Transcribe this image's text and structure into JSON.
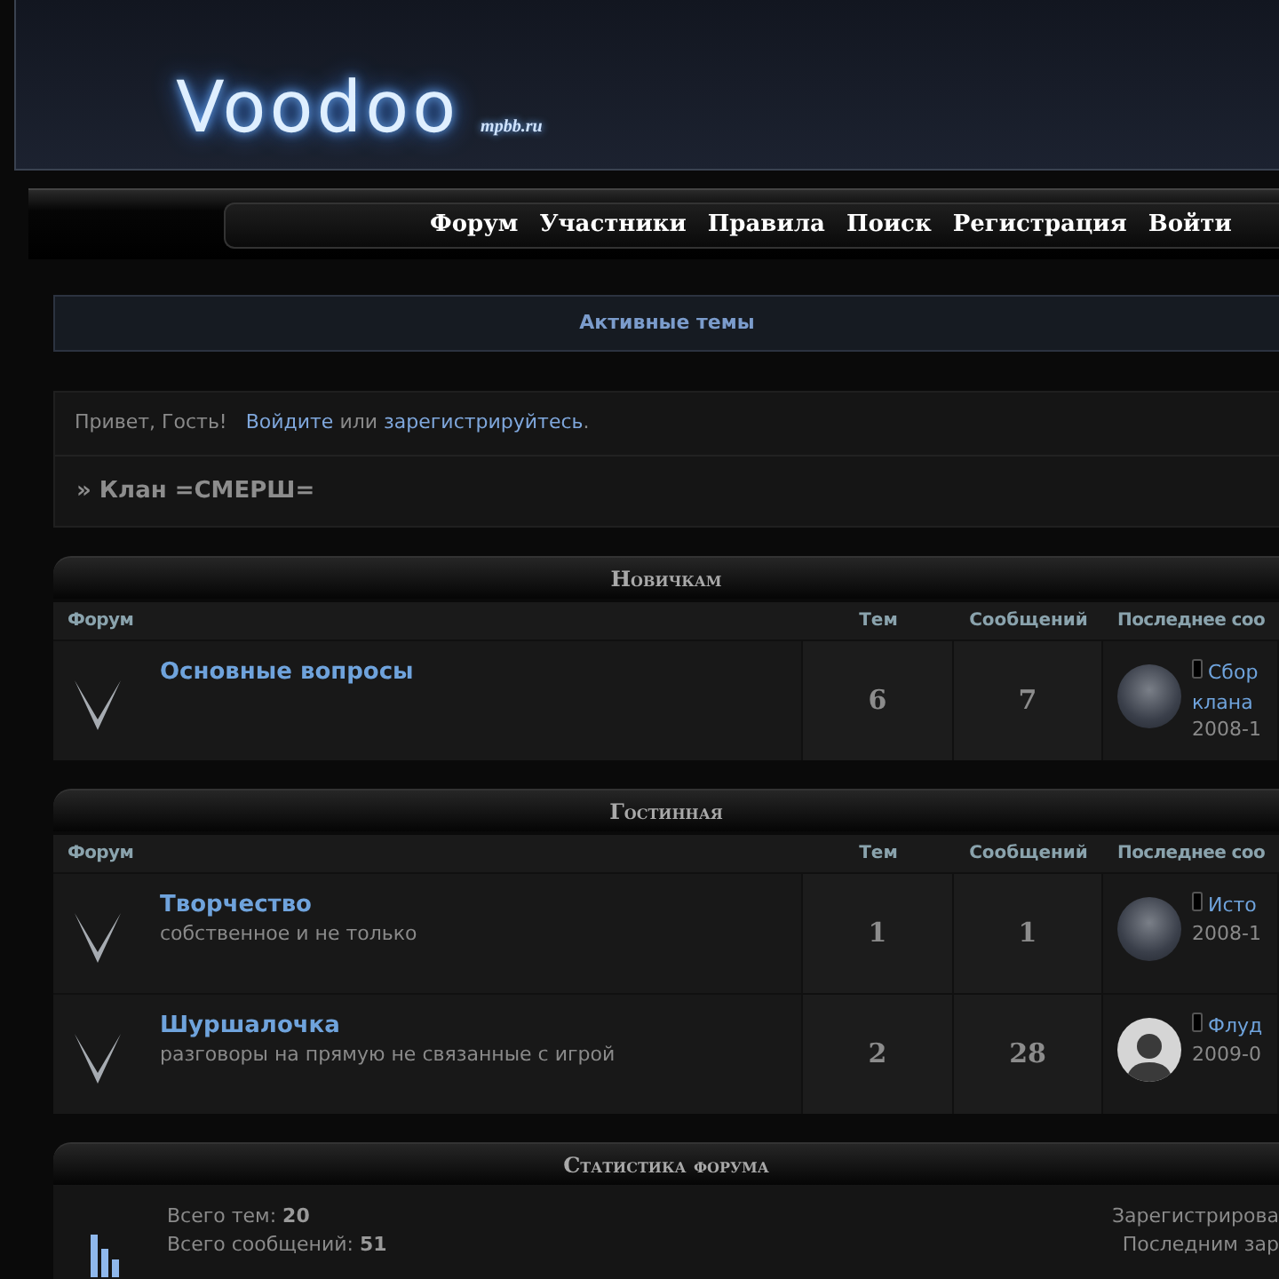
{
  "header": {
    "logo": "Voodoo",
    "site": "mpbb.ru"
  },
  "nav": [
    {
      "label": "Форум"
    },
    {
      "label": "Участники"
    },
    {
      "label": "Правила"
    },
    {
      "label": "Поиск"
    },
    {
      "label": "Регистрация"
    },
    {
      "label": "Войти"
    }
  ],
  "active_topics": "Активные темы",
  "welcome": {
    "greeting": "Привет, Гость!",
    "login": "Войдите",
    "or": "или",
    "register": "зарегистрируйтесь",
    "end": "."
  },
  "breadcrumb": "» Клан =СМЕРШ=",
  "categories": [
    {
      "title": "Новичкам",
      "columns": [
        "Форум",
        "Тем",
        "Сообщений",
        "Последнее соо"
      ],
      "forums": [
        {
          "name": "Основные вопросы",
          "topics": "6",
          "posts": "7",
          "last_post": {
            "kind": "photo",
            "topic_lines": [
              "Сбор",
              "клана"
            ],
            "date": "2008-1"
          }
        }
      ]
    },
    {
      "title": "Гостинная",
      "columns": [
        "Форум",
        "Тем",
        "Сообщений",
        "Последнее соо"
      ],
      "forums": [
        {
          "name": "Творчество",
          "description": "собственное и не только",
          "topics": "1",
          "posts": "1",
          "last_post": {
            "kind": "photo",
            "topic_lines": [
              "Исто"
            ],
            "date": "2008-1"
          }
        },
        {
          "name": "Шуршалочка",
          "description": "разговоры на прямую не связанные с игрой",
          "topics": "2",
          "posts": "28",
          "last_post": {
            "kind": "silhouette",
            "topic_lines": [
              "Флуд"
            ],
            "date": "2009-0"
          }
        }
      ]
    }
  ],
  "stats": {
    "title": "Статистика форума",
    "left": [
      {
        "label": "Всего тем:",
        "value": "20"
      },
      {
        "label": "Всего сообщений:",
        "value": "51"
      }
    ],
    "right": [
      "Зарегистрирова",
      "Последним зар"
    ]
  }
}
